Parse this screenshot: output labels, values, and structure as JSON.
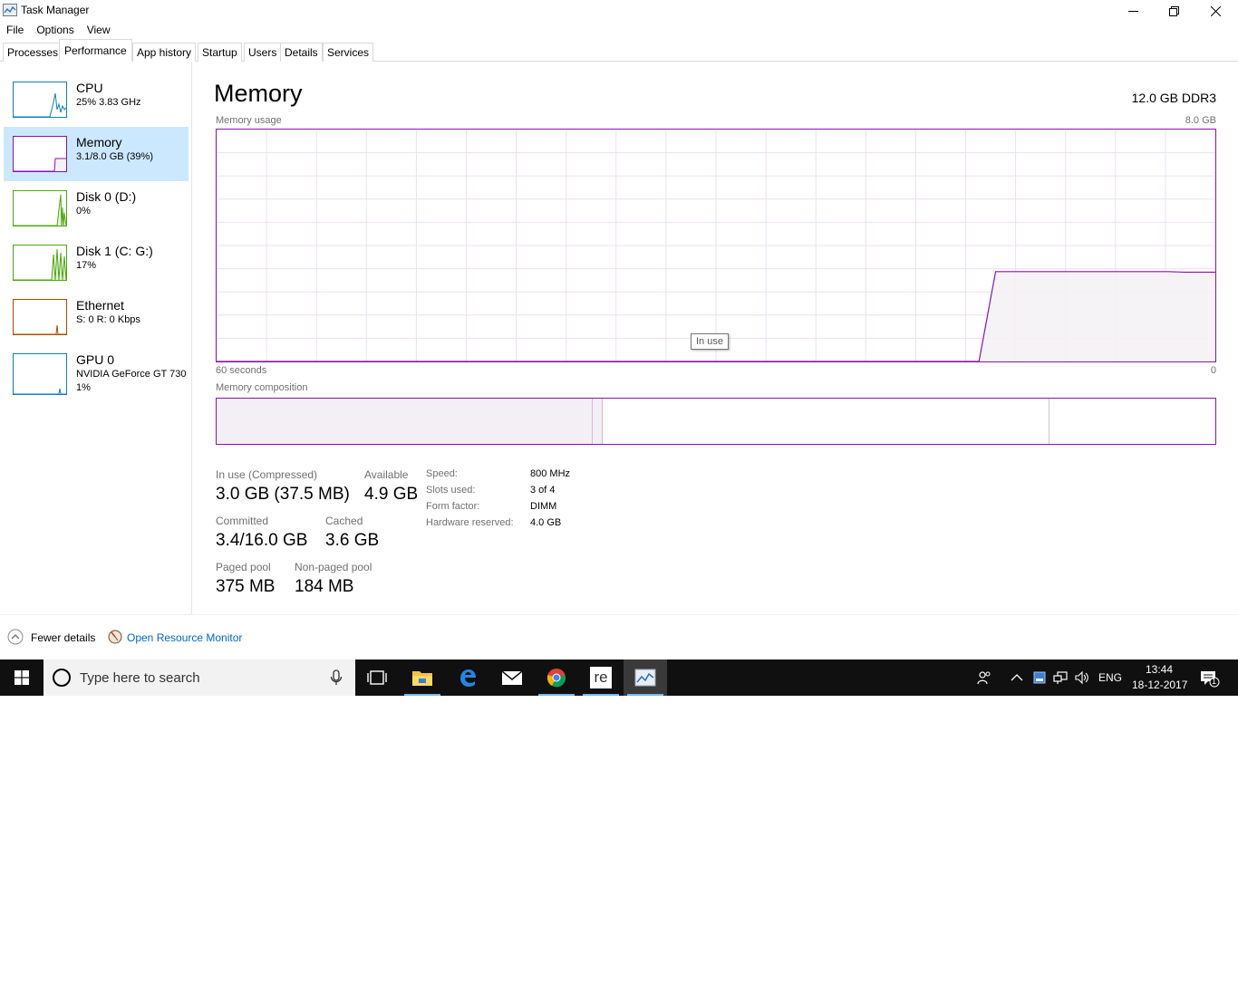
{
  "window": {
    "title": "Task Manager",
    "icons": {
      "app": "task-manager-icon",
      "minimize": "minimize-icon",
      "restore": "restore-icon",
      "close": "close-icon"
    }
  },
  "menu": [
    "File",
    "Options",
    "View"
  ],
  "tabs": [
    "Processes",
    "Performance",
    "App history",
    "Startup",
    "Users",
    "Details",
    "Services"
  ],
  "active_tab": "Performance",
  "sidebar": {
    "items": [
      {
        "name": "CPU",
        "sub": "25%  3.83 GHz",
        "sub2": "",
        "color": "#117dbb"
      },
      {
        "name": "Memory",
        "sub": "3.1/8.0 GB (39%)",
        "sub2": "",
        "color": "#8b12ae"
      },
      {
        "name": "Disk 0 (D:)",
        "sub": "0%",
        "sub2": "",
        "color": "#4da60c"
      },
      {
        "name": "Disk 1 (C: G:)",
        "sub": "17%",
        "sub2": "",
        "color": "#4da60c"
      },
      {
        "name": "Ethernet",
        "sub": "S: 0  R: 0 Kbps",
        "sub2": "",
        "color": "#a74f01"
      },
      {
        "name": "GPU 0",
        "sub": "NVIDIA GeForce GT 730",
        "sub2": "1%",
        "color": "#117dbb"
      }
    ],
    "selected": "Memory"
  },
  "main": {
    "title": "Memory",
    "spec": "12.0 GB DDR3",
    "usage_label": "Memory usage",
    "usage_max": "8.0 GB",
    "time_left": "60 seconds",
    "time_right": "0",
    "tooltip": "In use",
    "composition_label": "Memory composition",
    "accent": "#8b12ae",
    "fill": "#f4f2f4"
  },
  "chart_data": {
    "type": "area",
    "title": "Memory usage",
    "xlabel": "",
    "ylabel": "",
    "x_range": [
      60,
      0
    ],
    "ylim": [
      0,
      8.0
    ],
    "grid": true,
    "series": [
      {
        "name": "In use",
        "x": [
          60,
          45,
          30,
          14.2,
          13.2,
          7.5,
          3.7,
          2.8,
          1.9,
          0.9,
          0
        ],
        "values": [
          0,
          0,
          0,
          0,
          3.1,
          3.1,
          3.1,
          3.1,
          3.08,
          3.08,
          3.08
        ]
      }
    ],
    "composition": [
      {
        "segment": "in use",
        "fraction": 0.376
      },
      {
        "segment": "modified",
        "fraction": 0.01
      },
      {
        "segment": "standby",
        "fraction": 0.447
      },
      {
        "segment": "free",
        "fraction": 0.167
      }
    ]
  },
  "stats": {
    "in_use_label": "In use (Compressed)",
    "in_use_value": "3.0 GB (37.5 MB)",
    "available_label": "Available",
    "available_value": "4.9 GB",
    "committed_label": "Committed",
    "committed_value": "3.4/16.0 GB",
    "cached_label": "Cached",
    "cached_value": "3.6 GB",
    "paged_label": "Paged pool",
    "paged_value": "375 MB",
    "nonpaged_label": "Non-paged pool",
    "nonpaged_value": "184 MB"
  },
  "specs": [
    {
      "label": "Speed:",
      "value": "800 MHz"
    },
    {
      "label": "Slots used:",
      "value": "3 of 4"
    },
    {
      "label": "Form factor:",
      "value": "DIMM"
    },
    {
      "label": "Hardware reserved:",
      "value": "4.0 GB"
    }
  ],
  "footer": {
    "fewer_details": "Fewer details",
    "open_resource_monitor": "Open Resource Monitor",
    "icons": {
      "fewer": "chevron-up-circle-icon",
      "monitor": "resource-monitor-icon"
    }
  },
  "taskbar": {
    "search_placeholder": "Type here to search",
    "apps": [
      {
        "name": "task-view",
        "icon": "task-view-icon"
      },
      {
        "name": "file-explorer",
        "icon": "folder-icon"
      },
      {
        "name": "edge",
        "icon": "edge-icon"
      },
      {
        "name": "mail",
        "icon": "mail-icon"
      },
      {
        "name": "chrome",
        "icon": "chrome-icon"
      },
      {
        "name": "re-app",
        "icon": "re-app-icon",
        "glyph": "re"
      },
      {
        "name": "task-manager",
        "icon": "task-manager-icon"
      }
    ],
    "tray": {
      "language": "ENG",
      "time": "13:44",
      "date": "18-12-2017",
      "notification_count": "1"
    }
  }
}
